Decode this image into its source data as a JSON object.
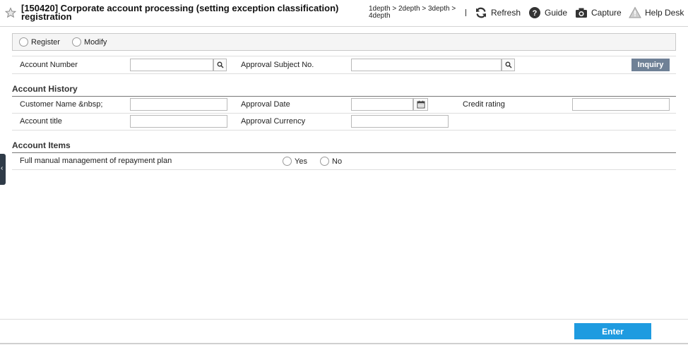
{
  "header": {
    "title_line1": "[150420] Corporate account processing (setting exception classification)",
    "title_line2": "registration",
    "breadcrumb_line1": "1depth > 2depth > 3depth >",
    "breadcrumb_line2": "4depth",
    "tools": {
      "refresh": "Refresh",
      "guide": "Guide",
      "capture": "Capture",
      "help": "Help Desk"
    }
  },
  "left_tab": {
    "glyph": "‹"
  },
  "mode": {
    "register": "Register",
    "modify": "Modify"
  },
  "search": {
    "account_number_label": "Account Number",
    "account_number_value": "",
    "approval_subject_label": "Approval Subject No.",
    "approval_subject_value": "",
    "inquiry_label": "Inquiry"
  },
  "account_history": {
    "title": "Account History",
    "customer_name_label": "Customer Name &nbsp;",
    "customer_name_value": "",
    "approval_date_label": "Approval Date",
    "approval_date_value": "",
    "credit_rating_label": "Credit rating",
    "credit_rating_value": "",
    "account_title_label": "Account title",
    "account_title_value": "",
    "approval_currency_label": "Approval Currency",
    "approval_currency_value": ""
  },
  "account_items": {
    "title": "Account Items",
    "repayment_label": "Full manual management of repayment plan",
    "yes": "Yes",
    "no": "No"
  },
  "footer": {
    "enter_label": "Enter"
  },
  "colors": {
    "inquiry_bg": "#6f8196",
    "enter_bg": "#1e9be0",
    "left_tab_bg": "#2f3b48"
  }
}
